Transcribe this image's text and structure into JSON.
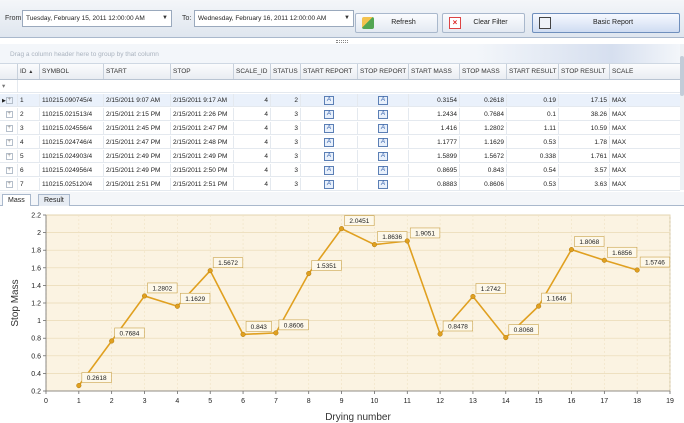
{
  "toolbar": {
    "from_label": "From:",
    "from_value": "Tuesday, February 15, 2011 12:00:00 AM",
    "to_label": "To:",
    "to_value": "Wednesday, February 16, 2011 12:00:00 AM",
    "refresh_label": "Refresh",
    "clear_filter_label": "Clear Filter",
    "basic_report_label": "Basic Report"
  },
  "group_panel_text": "Drag a column header here to group by that column",
  "grid": {
    "columns": [
      "ID",
      "SYMBOL",
      "START",
      "STOP",
      "SCALE_ID",
      "STATUS",
      "START REPORT",
      "STOP REPORT",
      "START MASS",
      "STOP MASS",
      "START RESULT",
      "STOP RESULT",
      "SCALE"
    ],
    "rows": [
      [
        "1",
        "110215.090745/4",
        "2/15/2011 9:07 AM",
        "2/15/2011 9:17 AM",
        "4",
        "2",
        "A",
        "A",
        "0.3154",
        "0.2618",
        "0.19",
        "17.15",
        "MAX"
      ],
      [
        "2",
        "110215.021513/4",
        "2/15/2011 2:15 PM",
        "2/15/2011 2:26 PM",
        "4",
        "3",
        "A",
        "A",
        "1.2434",
        "0.7684",
        "0.1",
        "38.26",
        "MAX"
      ],
      [
        "3",
        "110215.024556/4",
        "2/15/2011 2:45 PM",
        "2/15/2011 2:47 PM",
        "4",
        "3",
        "A",
        "A",
        "1.416",
        "1.2802",
        "1.11",
        "10.59",
        "MAX"
      ],
      [
        "4",
        "110215.024746/4",
        "2/15/2011 2:47 PM",
        "2/15/2011 2:48 PM",
        "4",
        "3",
        "A",
        "A",
        "1.1777",
        "1.1629",
        "0.53",
        "1.78",
        "MAX"
      ],
      [
        "5",
        "110215.024903/4",
        "2/15/2011 2:49 PM",
        "2/15/2011 2:49 PM",
        "4",
        "3",
        "A",
        "A",
        "1.5899",
        "1.5672",
        "0.338",
        "1.761",
        "MAX"
      ],
      [
        "6",
        "110215.024956/4",
        "2/15/2011 2:49 PM",
        "2/15/2011 2:50 PM",
        "4",
        "3",
        "A",
        "A",
        "0.8695",
        "0.843",
        "0.54",
        "3.57",
        "MAX"
      ],
      [
        "7",
        "110215.025120/4",
        "2/15/2011 2:51 PM",
        "2/15/2011 2:51 PM",
        "4",
        "3",
        "A",
        "A",
        "0.8883",
        "0.8606",
        "0.53",
        "3.63",
        "MAX"
      ]
    ]
  },
  "tabs": [
    "Mass",
    "Result"
  ],
  "colors": {
    "series": "#e0a020",
    "plot_bg": "#fbf3e2",
    "accent": "#6f8fbd"
  },
  "chart_data": {
    "type": "line",
    "x": [
      1,
      2,
      3,
      4,
      5,
      6,
      7,
      8,
      9,
      10,
      11,
      12,
      13,
      14,
      15,
      16,
      17,
      18
    ],
    "values": [
      0.2618,
      0.7684,
      1.2802,
      1.1629,
      1.5672,
      0.843,
      0.8606,
      1.5351,
      2.0451,
      1.8636,
      1.9051,
      0.8478,
      1.2742,
      0.8068,
      1.1646,
      1.8068,
      1.6856,
      1.5746
    ],
    "labels": [
      "0.2618",
      "0.7684",
      "1.2802",
      "1.1629",
      "1.5672",
      "0.843",
      "0.8606",
      "1.5351",
      "2.0451",
      "1.8636",
      "1.9051",
      "0.8478",
      "1.2742",
      "0.8068",
      "1.1646",
      "1.8068",
      "1.6856",
      "1.5746"
    ],
    "xlabel": "Drying number",
    "ylabel": "Stop Mass",
    "xlim": [
      0,
      19
    ],
    "ylim": [
      0.2,
      2.2
    ],
    "xticks": [
      "0",
      "1",
      "2",
      "3",
      "4",
      "5",
      "6",
      "7",
      "8",
      "9",
      "10",
      "11",
      "12",
      "13",
      "14",
      "15",
      "16",
      "17",
      "18",
      "19"
    ],
    "yticks": [
      "0.2",
      "0.4",
      "0.6",
      "0.8",
      "1",
      "1.2",
      "1.4",
      "1.6",
      "1.8",
      "2",
      "2.2"
    ],
    "grid": true
  }
}
